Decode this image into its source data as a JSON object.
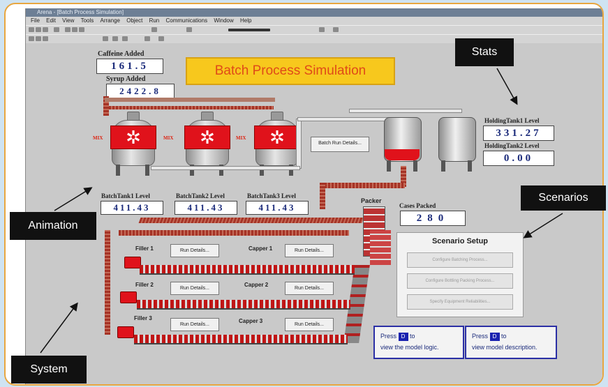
{
  "window": {
    "title": "Arena - [Batch Process Simulation]"
  },
  "menu": [
    "File",
    "Edit",
    "View",
    "Tools",
    "Arrange",
    "Object",
    "Run",
    "Communications",
    "Window",
    "Help"
  ],
  "banner": {
    "title": "Batch Process Simulation"
  },
  "caffeine": {
    "label": "Caffeine Added",
    "value": "161.5"
  },
  "syrup": {
    "label": "Syrup Added",
    "value": "2422.8"
  },
  "batch_tanks": [
    {
      "label": "BatchTank1 Level",
      "value": "411.43"
    },
    {
      "label": "BatchTank2 Level",
      "value": "411.43"
    },
    {
      "label": "BatchTank3 Level",
      "value": "411.43"
    }
  ],
  "holding_tanks": [
    {
      "label": "HoldingTank1 Level",
      "value": "331.27"
    },
    {
      "label": "HoldingTank2 Level",
      "value": "0.00"
    }
  ],
  "mix_tags": [
    "MIX",
    "MIX",
    "MIX"
  ],
  "batch_run_details": "Batch Run Details...",
  "packer": {
    "label": "Packer"
  },
  "cases_packed": {
    "label": "Cases Packed",
    "value": "280"
  },
  "lines": [
    {
      "filler": "Filler 1",
      "capper": "Capper 1",
      "filler_btn": "Run Details...",
      "capper_btn": "Run Details..."
    },
    {
      "filler": "Filler 2",
      "capper": "Capper 2",
      "filler_btn": "Run Details...",
      "capper_btn": "Run Details..."
    },
    {
      "filler": "Filler 3",
      "capper": "Capper 3",
      "filler_btn": "Run Details...",
      "capper_btn": "Run Details..."
    }
  ],
  "scenario": {
    "title": "Scenario Setup",
    "buttons": [
      "Configure Batching Process...",
      "Configure Bottling Packing Process...",
      "Specify Equipment Reliabilities..."
    ]
  },
  "press": [
    {
      "pre": "Press",
      "key": "D",
      "post": "to",
      "post2": "view the model logic."
    },
    {
      "pre": "Press",
      "key": "D",
      "post": "to",
      "post2": "view model description."
    }
  ],
  "callouts": {
    "stats": "Stats",
    "scenarios": "Scenarios",
    "animation": "Animation",
    "system": "System"
  }
}
